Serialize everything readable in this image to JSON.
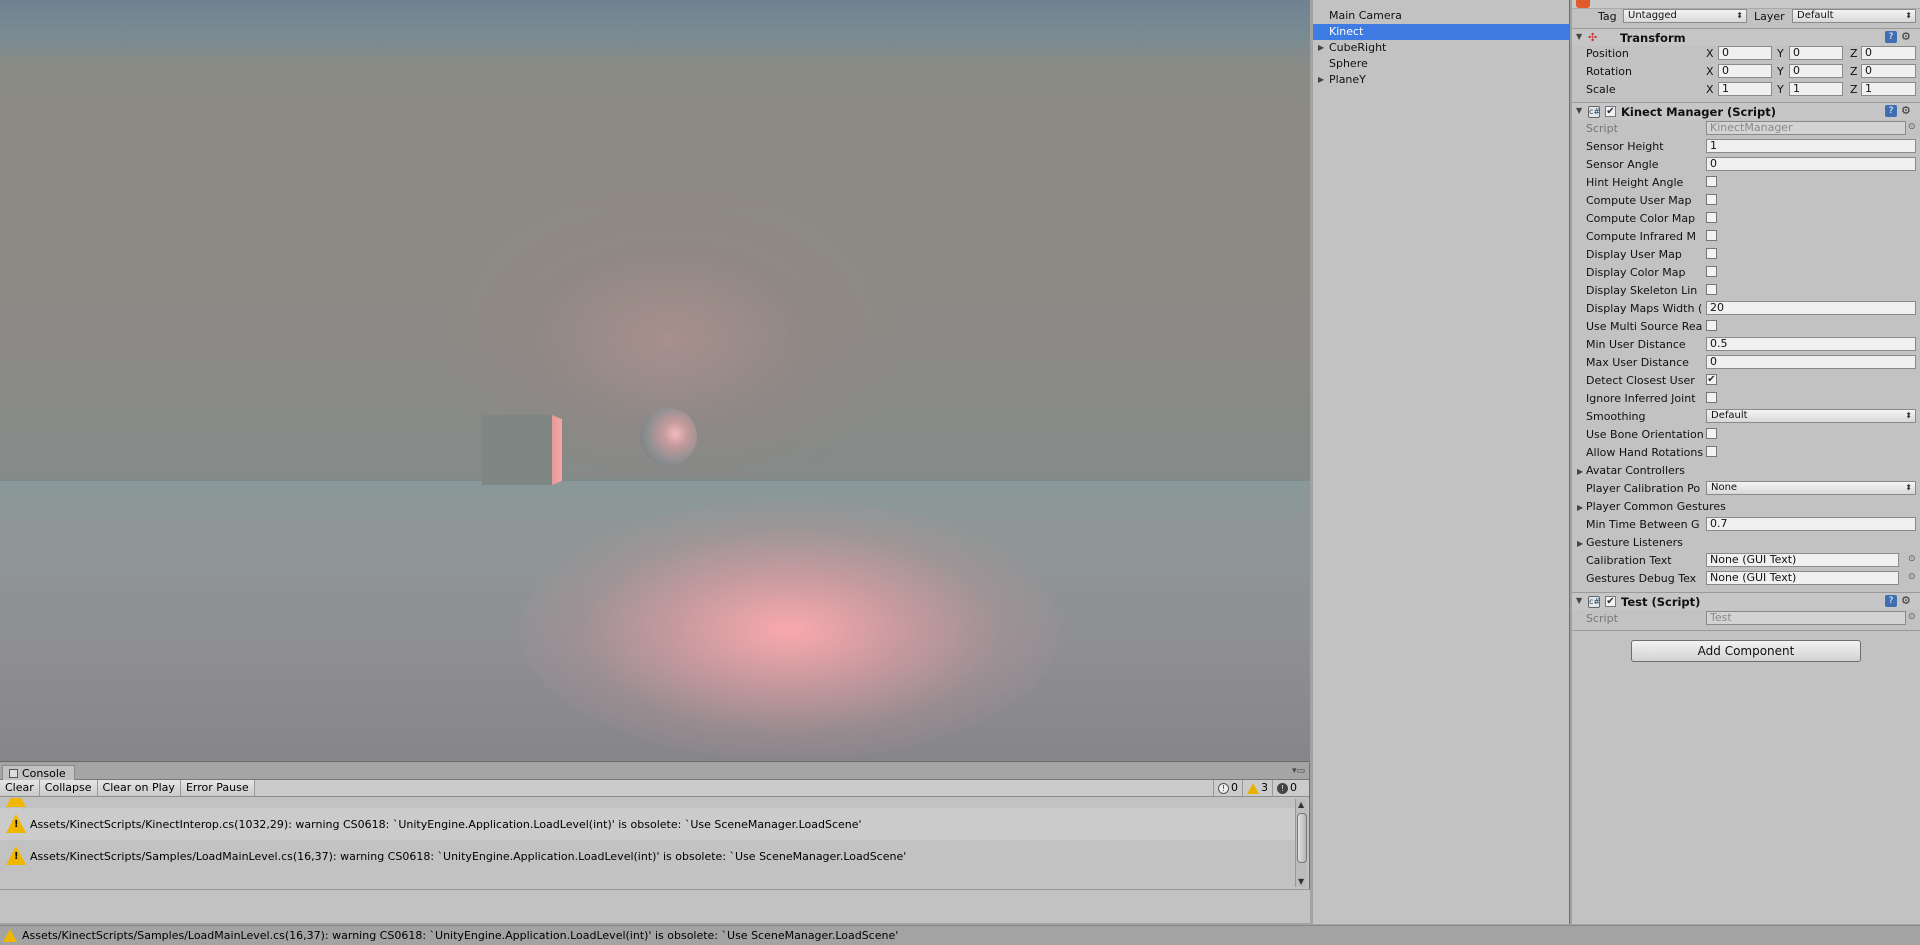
{
  "console": {
    "tab_label": "Console",
    "toolbar": {
      "clear": "Clear",
      "collapse": "Collapse",
      "clear_on_play": "Clear on Play",
      "error_pause": "Error Pause",
      "info_count": "0",
      "warning_count": "3",
      "error_count": "0"
    },
    "logs": [
      "Assets/KinectScripts/KinectInterop.cs(1032,29): warning CS0618: `UnityEngine.Application.LoadLevel(int)' is obsolete: `Use SceneManager.LoadScene'",
      "Assets/KinectScripts/Samples/LoadMainLevel.cs(16,37): warning CS0618: `UnityEngine.Application.LoadLevel(int)' is obsolete: `Use SceneManager.LoadScene'"
    ]
  },
  "status_bar": {
    "message": "Assets/KinectScripts/Samples/LoadMainLevel.cs(16,37): warning CS0618: `UnityEngine.Application.LoadLevel(int)' is obsolete: `Use SceneManager.LoadScene'"
  },
  "hierarchy": {
    "items": [
      {
        "label": "Main Camera"
      },
      {
        "label": "Kinect"
      },
      {
        "label": "CubeRight"
      },
      {
        "label": "Sphere"
      },
      {
        "label": "PlaneY"
      }
    ]
  },
  "inspector": {
    "tag_label": "Tag",
    "tag_value": "Untagged",
    "layer_label": "Layer",
    "layer_value": "Default",
    "transform": {
      "title": "Transform",
      "position_label": "Position",
      "rotation_label": "Rotation",
      "scale_label": "Scale",
      "x": "X",
      "y": "Y",
      "z": "Z",
      "position": [
        "0",
        "0",
        "0"
      ],
      "rotation": [
        "0",
        "0",
        "0"
      ],
      "scale": [
        "1",
        "1",
        "1"
      ]
    },
    "kinect_manager": {
      "title": "Kinect Manager (Script)",
      "script_label": "Script",
      "script_value": "KinectManager",
      "sensor_height_label": "Sensor Height",
      "sensor_height": "1",
      "sensor_angle_label": "Sensor Angle",
      "sensor_angle": "0",
      "hint_height_angle_label": "Hint Height Angle",
      "compute_user_map_label": "Compute User Map",
      "compute_color_map_label": "Compute Color Map",
      "compute_infrared_label": "Compute Infrared M",
      "display_user_map_label": "Display User Map",
      "display_color_map_label": "Display Color Map",
      "display_skeleton_label": "Display Skeleton Lin",
      "display_maps_width_label": "Display Maps Width (",
      "display_maps_width": "20",
      "use_multi_source_label": "Use Multi Source Rea",
      "min_user_distance_label": "Min User Distance",
      "min_user_distance": "0.5",
      "max_user_distance_label": "Max User Distance",
      "max_user_distance": "0",
      "detect_closest_label": "Detect Closest User",
      "detect_closest_check": "✔",
      "ignore_inferred_label": "Ignore Inferred Joint",
      "smoothing_label": "Smoothing",
      "smoothing_value": "Default",
      "use_bone_label": "Use Bone Orientation",
      "allow_hand_label": "Allow Hand Rotations",
      "avatar_controllers_label": "Avatar Controllers",
      "player_calibration_label": "Player Calibration Po",
      "player_calibration_value": "None",
      "player_common_gestures_label": "Player Common Gestures",
      "min_time_between_label": "Min Time Between G",
      "min_time_between": "0.7",
      "gesture_listeners_label": "Gesture Listeners",
      "calibration_text_label": "Calibration Text",
      "calibration_text_value": "None (GUI Text)",
      "gestures_debug_label": "Gestures Debug Tex",
      "gestures_debug_value": "None (GUI Text)"
    },
    "test_script": {
      "title": "Test (Script)",
      "script_label": "Script",
      "script_value": "Test"
    },
    "add_component": "Add Component"
  },
  "colors": {
    "selection": "#3e7ce4",
    "warning": "#efb700",
    "panel": "#c2c2c2"
  }
}
